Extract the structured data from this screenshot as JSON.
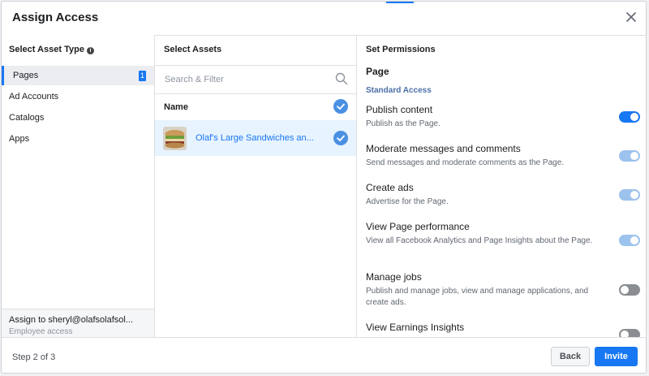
{
  "dialog": {
    "title": "Assign Access",
    "close_icon": "close-icon"
  },
  "asset_types": {
    "heading": "Select Asset Type",
    "items": [
      {
        "label": "Pages",
        "count": "1",
        "selected": true
      },
      {
        "label": "Ad Accounts"
      },
      {
        "label": "Catalogs"
      },
      {
        "label": "Apps"
      }
    ],
    "assign_line": "Assign to sheryl@olafsolafsol...",
    "assign_role": "Employee access"
  },
  "assets": {
    "heading": "Select Assets",
    "search_placeholder": "Search & Filter",
    "name_header": "Name",
    "rows": [
      {
        "name": "Olaf's Large Sandwiches an...",
        "selected": true
      }
    ]
  },
  "permissions": {
    "heading": "Set Permissions",
    "page_label": "Page",
    "section_label": "Standard Access",
    "items": [
      {
        "title": "Publish content",
        "desc": "Publish as the Page.",
        "state": "on"
      },
      {
        "title": "Moderate messages and comments",
        "desc": "Send messages and moderate comments as the Page.",
        "state": "on-disabled"
      },
      {
        "title": "Create ads",
        "desc": "Advertise for the Page.",
        "state": "on-disabled"
      },
      {
        "title": "View Page performance",
        "desc": "View all Facebook Analytics and Page Insights about the Page.",
        "state": "on-disabled"
      },
      {
        "title": "Manage jobs",
        "desc": "Publish and manage jobs, view and manage applications, and create ads.",
        "state": "off"
      },
      {
        "title": "View Earnings Insights",
        "desc": "",
        "state": "off"
      }
    ]
  },
  "footer": {
    "step": "Step 2 of 3",
    "back_label": "Back",
    "invite_label": "Invite"
  },
  "colors": {
    "accent": "#1877f2",
    "selected_row": "#e7f3ff",
    "toggle_disabled_on": "#9cc2ee",
    "toggle_off": "#8a8d91"
  }
}
